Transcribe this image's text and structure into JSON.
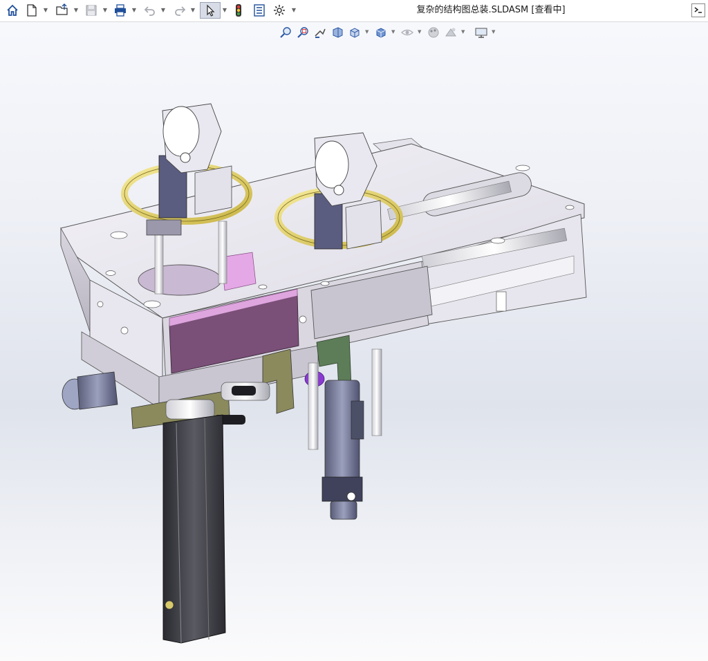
{
  "window": {
    "title": "复杂的结构图总装.SLDASM [查看中]"
  },
  "toolbar": {
    "items": [
      {
        "name": "home-icon",
        "label": "Home"
      },
      {
        "name": "new-document-icon",
        "label": "New"
      },
      {
        "name": "open-folder-icon",
        "label": "Open"
      },
      {
        "name": "save-icon",
        "label": "Save"
      },
      {
        "name": "print-icon",
        "label": "Print"
      },
      {
        "name": "undo-icon",
        "label": "Undo"
      },
      {
        "name": "redo-icon",
        "label": "Redo"
      },
      {
        "name": "select-pointer-icon",
        "label": "Select"
      },
      {
        "name": "traffic-light-icon",
        "label": "Rebuild"
      },
      {
        "name": "file-properties-icon",
        "label": "File Properties"
      },
      {
        "name": "options-gear-icon",
        "label": "Options"
      }
    ]
  },
  "heads_up_view": {
    "items": [
      "zoom-to-fit-icon",
      "zoom-to-area-icon",
      "previous-view-icon",
      "section-view-icon",
      "view-orientation-icon",
      "display-style-icon",
      "hide-show-items-icon",
      "edit-appearance-icon",
      "apply-scene-icon",
      "view-settings-icon"
    ]
  },
  "colors": {
    "accent": "#3a6fc4",
    "plate": "#e8e6ee",
    "plate_shadow": "#b8b5c2",
    "magenta": "#d79ad8",
    "purple_dark": "#6e4a6e",
    "gold": "#e8d66a",
    "dark_rail": "#3a3a40",
    "olive": "#8a8a5a",
    "green": "#5f7f5a"
  }
}
